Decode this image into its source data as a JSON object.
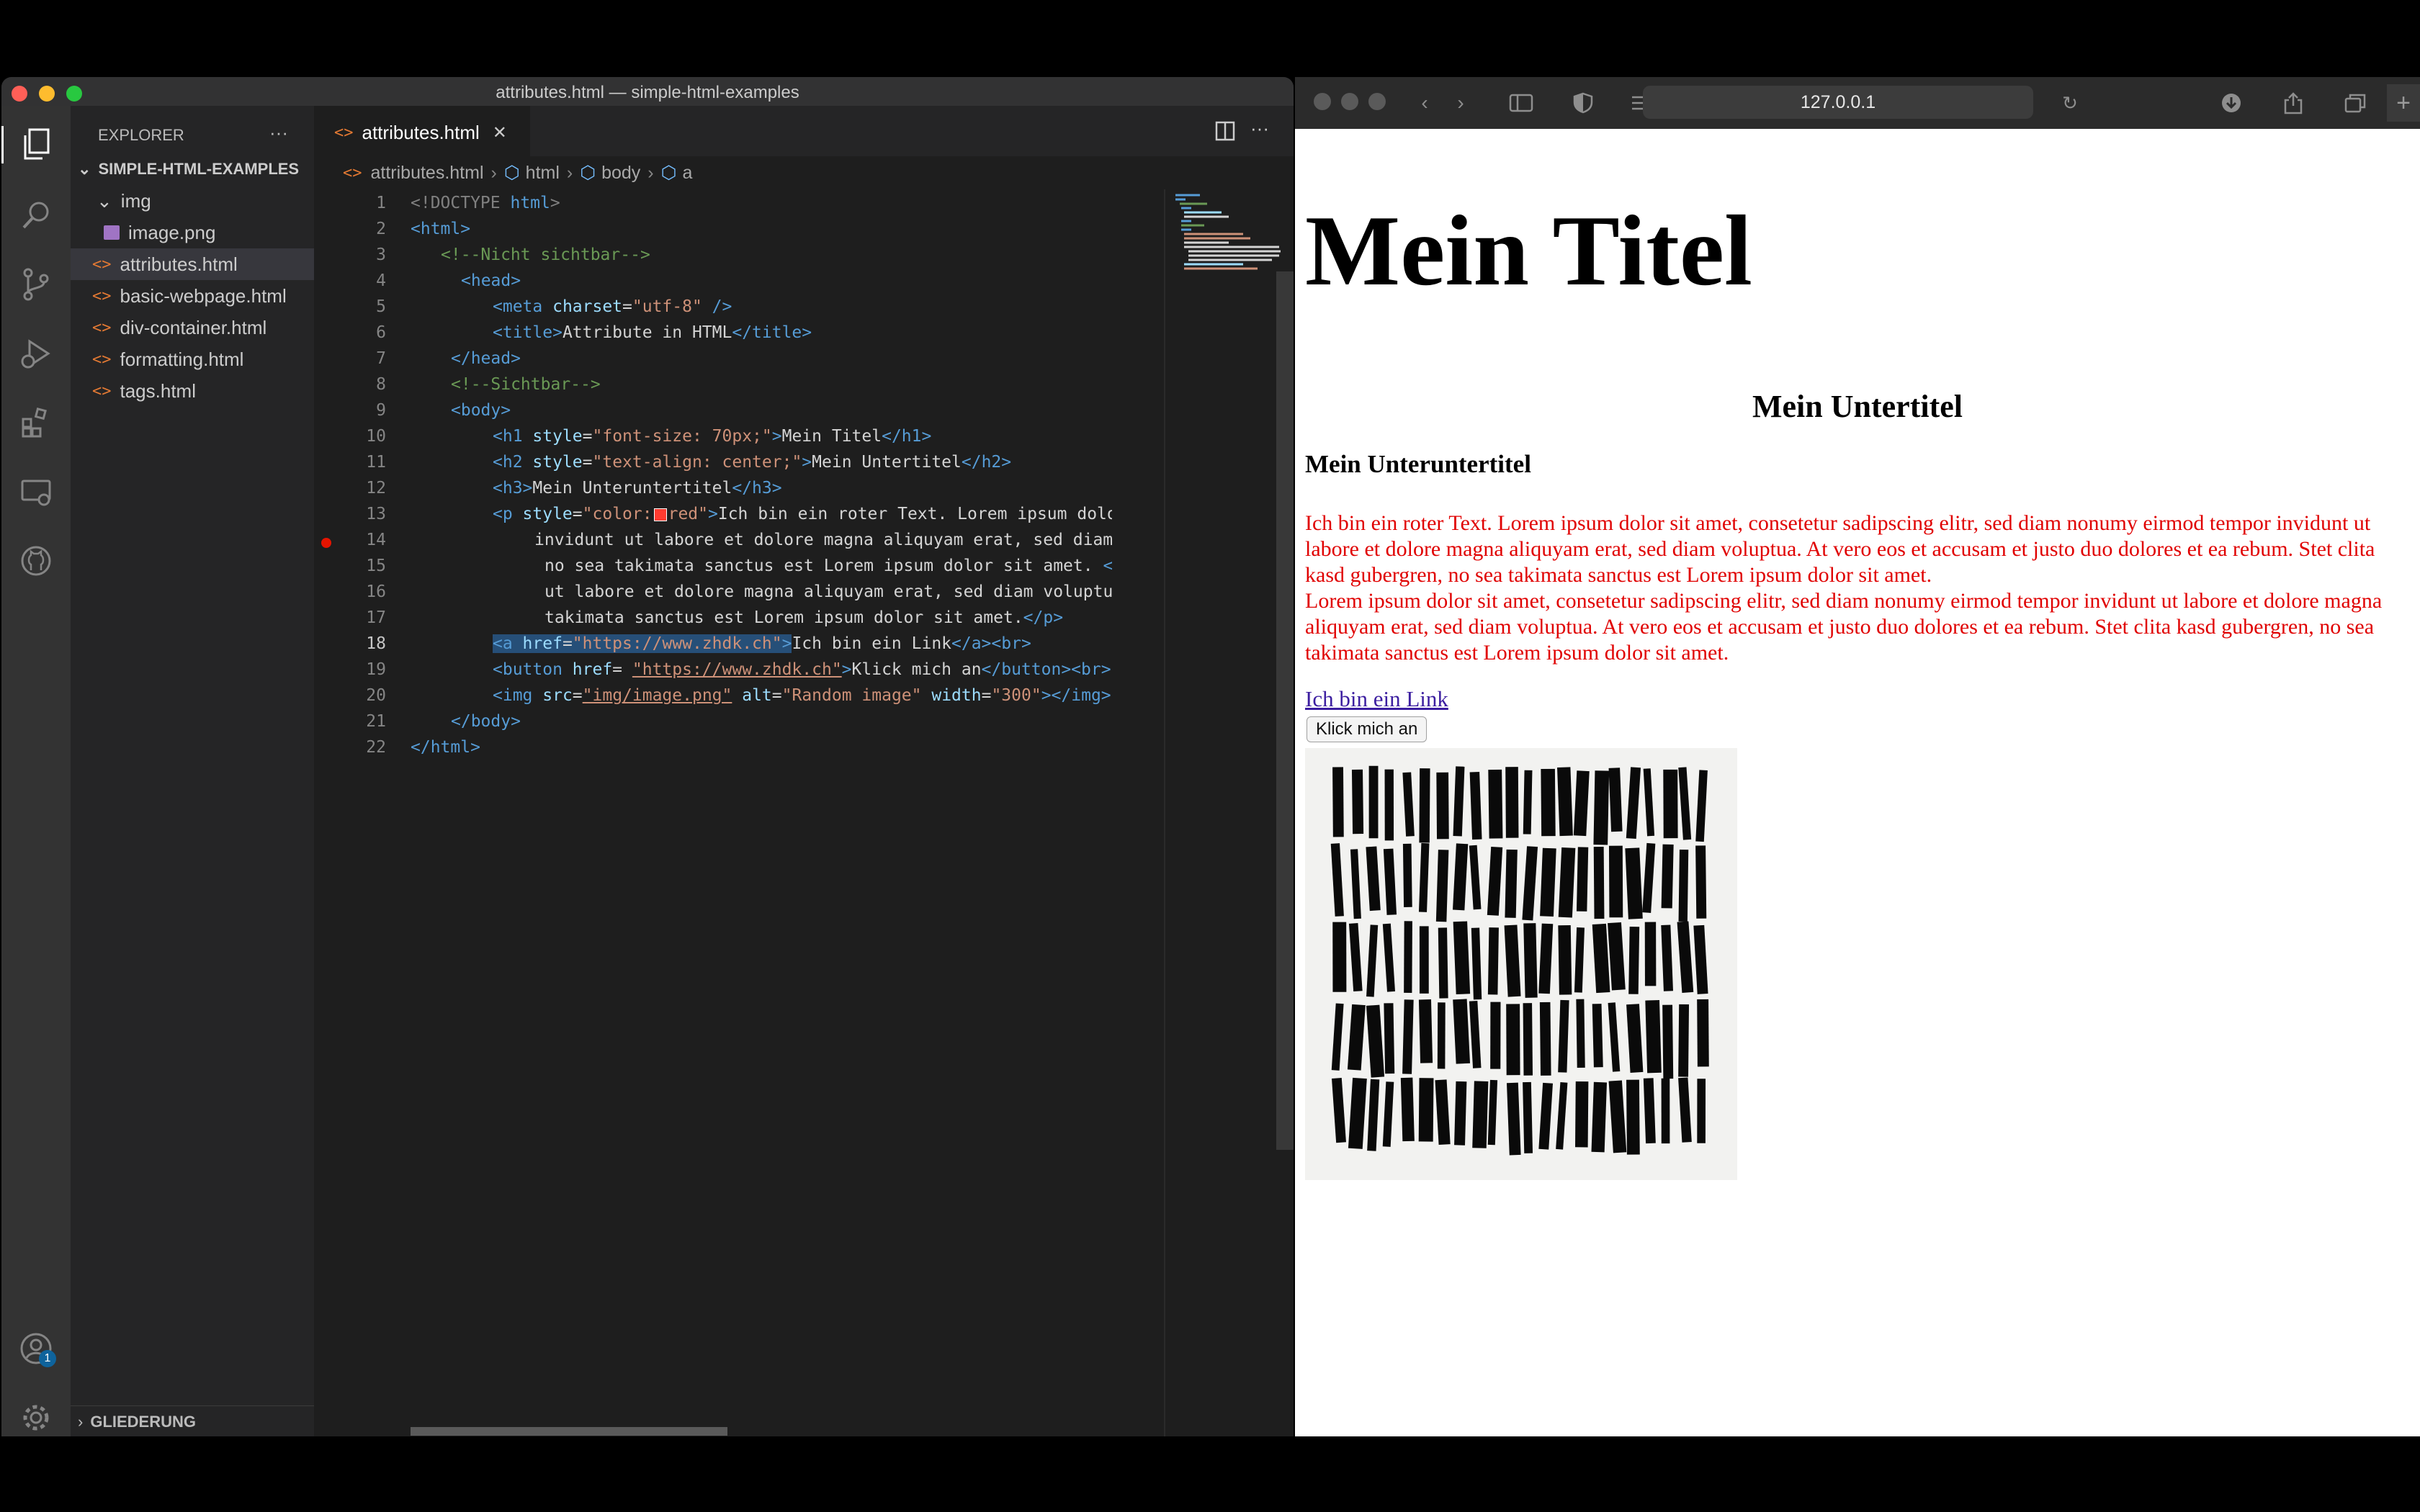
{
  "vscode": {
    "window_title": "attributes.html — simple-html-examples",
    "explorer": {
      "header": "EXPLORER",
      "more": "···",
      "project": "SIMPLE-HTML-EXAMPLES",
      "items": [
        {
          "label": "img",
          "type": "folder"
        },
        {
          "label": "image.png",
          "type": "image"
        },
        {
          "label": "attributes.html",
          "type": "html",
          "selected": true
        },
        {
          "label": "basic-webpage.html",
          "type": "html"
        },
        {
          "label": "div-container.html",
          "type": "html"
        },
        {
          "label": "formatting.html",
          "type": "html"
        },
        {
          "label": "tags.html",
          "type": "html"
        }
      ],
      "outline": "GLIEDERUNG"
    },
    "tab": {
      "label": "attributes.html",
      "close": "✕"
    },
    "breadcrumb": [
      "attributes.html",
      "html",
      "body",
      "a"
    ],
    "accounts_badge": "1",
    "code_lines": [
      "1",
      "2",
      "3",
      "4",
      "5",
      "6",
      "7",
      "8",
      "9",
      "10",
      "11",
      "12",
      "13",
      "14",
      "15",
      "16",
      "17",
      "18",
      "19",
      "20",
      "21",
      "22"
    ],
    "code": {
      "l1a": "<!DOCTYPE ",
      "l1b": "html",
      "l1c": ">",
      "l2": "<html>",
      "l3": "<!--Nicht sichtbar-->",
      "l4": "<head>",
      "l5a": "<meta ",
      "l5b": "charset",
      "l5c": "=",
      "l5d": "\"utf-8\"",
      "l5e": " />",
      "l6a": "<title>",
      "l6b": "Attribute in HTML",
      "l6c": "</title>",
      "l7": "</head>",
      "l8": "<!--Sichtbar-->",
      "l9": "<body>",
      "l10a": "<h1 ",
      "l10b": "style",
      "l10c": "=",
      "l10d": "\"font-size: 70px;\"",
      "l10e": ">",
      "l10f": "Mein Titel",
      "l10g": "</h1>",
      "l11a": "<h2 ",
      "l11b": "style",
      "l11c": "=",
      "l11d": "\"text-align: center;\"",
      "l11e": ">",
      "l11f": "Mein Untertitel",
      "l11g": "</h2>",
      "l12a": "<h3>",
      "l12b": "Mein Unteruntertitel",
      "l12c": "</h3>",
      "l13a": "<p ",
      "l13b": "style",
      "l13c": "=",
      "l13d": "\"color:",
      "l13e": "red\"",
      "l13f": ">",
      "l13g": "Ich bin ein roter Text. Lorem ipsum dolor",
      "l14": "invidunt ut labore et dolore magna aliquyam erat, sed diam v",
      "l15a": "no sea takimata sanctus est Lorem ipsum dolor sit amet. ",
      "l15b": "<br",
      "l16": "ut labore et dolore magna aliquyam erat, sed diam voluptua.",
      "l17a": "takimata sanctus est Lorem ipsum dolor sit amet.",
      "l17b": "</p>",
      "l18a": "<a ",
      "l18b": "href",
      "l18c": "=",
      "l18d": "\"https://www.zhdk.ch\"",
      "l18e": ">",
      "l18f": "Ich bin ein Link",
      "l18g": "</a><br>",
      "l19a": "<button ",
      "l19b": "href",
      "l19c": "= ",
      "l19d": "\"https://www.zhdk.ch\"",
      "l19e": ">",
      "l19f": "Klick mich an",
      "l19g": "</button><br>",
      "l20a": "<img ",
      "l20b": "src",
      "l20c": "=",
      "l20d": "\"img/image.png\"",
      "l20e": " alt",
      "l20f": "=",
      "l20g": "\"Random image\"",
      "l20h": " width",
      "l20i": "=",
      "l20j": "\"300\"",
      "l20k": "></img>",
      "l21": "</body>",
      "l22": "</html>"
    },
    "colors": {
      "tag": "#569cd6",
      "attr": "#9cdcfe",
      "string": "#ce9178",
      "comment": "#6a9955",
      "breakpoint": "#e51400"
    }
  },
  "browser": {
    "url": "127.0.0.1",
    "page": {
      "h1": "Mein Titel",
      "h2": "Mein Untertitel",
      "h3": "Mein Unteruntertitel",
      "paragraph_1": "Ich bin ein roter Text. Lorem ipsum dolor sit amet, consetetur sadipscing elitr, sed diam nonumy eirmod tempor invidunt ut labore et dolore magna aliquyam erat, sed diam voluptua. At vero eos et accusam et justo duo dolores et ea rebum. Stet clita kasd gubergren, no sea takimata sanctus est Lorem ipsum dolor sit amet.",
      "paragraph_2": "Lorem ipsum dolor sit amet, consetetur sadipscing elitr, sed diam nonumy eirmod tempor invidunt ut labore et dolore magna aliquyam erat, sed diam voluptua. At vero eos et accusam et justo duo dolores et ea rebum. Stet clita kasd gubergren, no sea takimata sanctus est Lorem ipsum dolor sit amet.",
      "link": "Ich bin ein Link",
      "button": "Klick mich an",
      "text_color": "#e00000",
      "link_color": "#3c1ea0"
    }
  }
}
